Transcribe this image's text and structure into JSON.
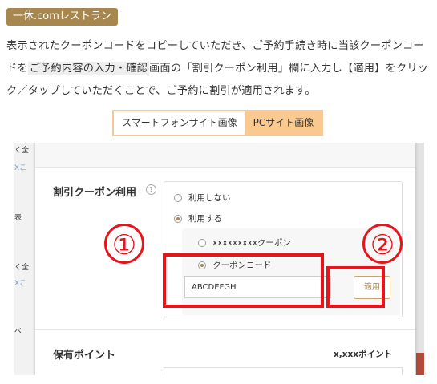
{
  "header": {
    "tag": "一休.comレストラン"
  },
  "description": {
    "part1": "表示されたクーポンコードをコピーしていただき、ご予約手続き時に当該クーポンコードを",
    "highlight": "ご予約内容の入力・確認",
    "part2": "画面の「割引クーポン利用」欄に入力し【適用】をクリック／タップしていただくことで、ご予約に割引が適用されます。"
  },
  "view_switch": {
    "smartphone_label": "スマートフォンサイト画像",
    "pc_label": "PCサイト画像",
    "selected": "PCサイト画像"
  },
  "screenshot": {
    "left_fragments": [
      "く全",
      "Xこ",
      "表",
      "く全",
      "Xこ",
      "ベ"
    ],
    "coupon_label": "割引クーポン利用",
    "help_icon": "question-circle-icon",
    "options": [
      {
        "label": "利用しない",
        "selected": false
      },
      {
        "label": "利用する",
        "selected": true
      }
    ],
    "sub_options": [
      {
        "label": "xxxxxxxxxクーポン",
        "selected": false
      },
      {
        "label": "クーポンコード",
        "selected": true
      }
    ],
    "code_value": "ABCDEFGH",
    "apply_label": "適用",
    "points_label": "保有ポイント",
    "points_value": "x,xxxポイント",
    "markers": [
      "①",
      "②"
    ],
    "highlight_color": "#e8141b",
    "accent_color": "#a8874e"
  }
}
